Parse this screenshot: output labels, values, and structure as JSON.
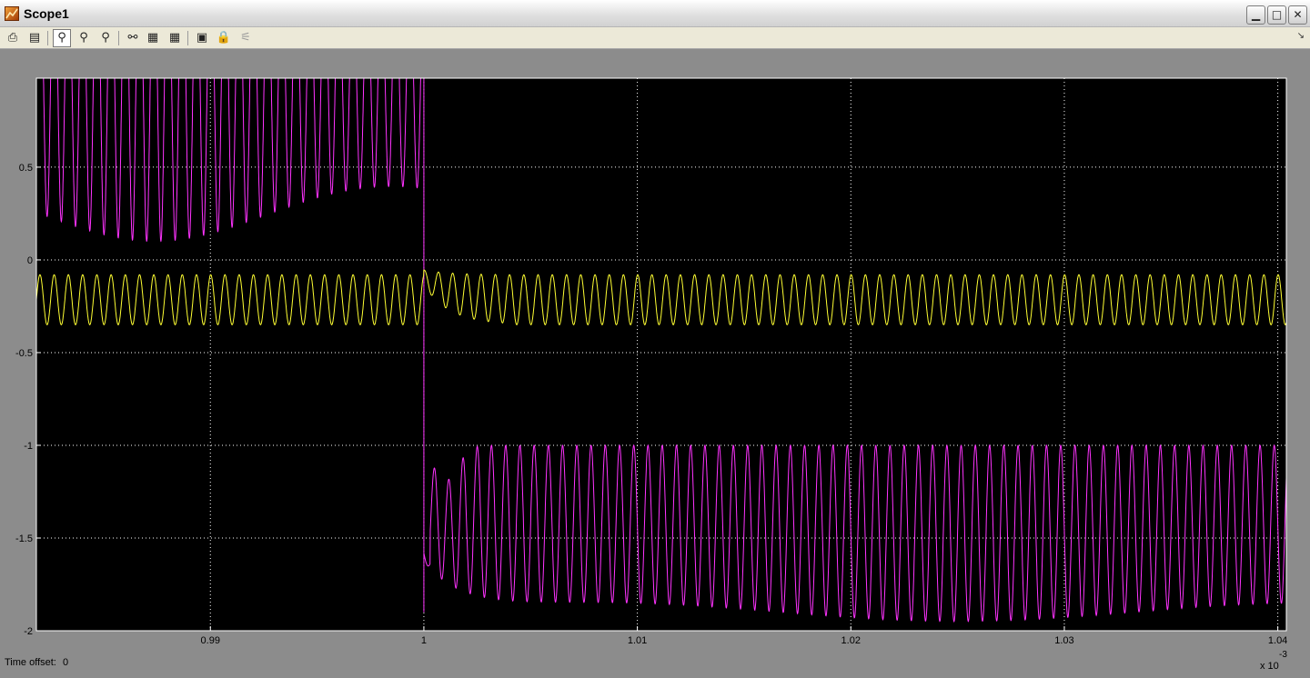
{
  "window": {
    "title": "Scope1",
    "controls": [
      "minimize",
      "maximize",
      "close"
    ]
  },
  "toolbar": {
    "buttons": [
      {
        "name": "print-icon",
        "glyph": "⎙",
        "state": "enabled"
      },
      {
        "name": "parameters-icon",
        "glyph": "▤",
        "state": "enabled"
      },
      {
        "name": "zoom-icon",
        "glyph": "⚲",
        "state": "active"
      },
      {
        "name": "zoom-x-icon",
        "glyph": "⚲",
        "state": "enabled"
      },
      {
        "name": "zoom-y-icon",
        "glyph": "⚲",
        "state": "enabled"
      },
      {
        "name": "autoscale-icon",
        "glyph": "⚯",
        "state": "enabled"
      },
      {
        "name": "save-axes-icon",
        "glyph": "▦",
        "state": "enabled"
      },
      {
        "name": "restore-axes-icon",
        "glyph": "▦",
        "state": "enabled"
      },
      {
        "name": "floating-scope-icon",
        "glyph": "▣",
        "state": "enabled"
      },
      {
        "name": "lock-axes-icon",
        "glyph": "🔒",
        "state": "disabled"
      },
      {
        "name": "signal-selection-icon",
        "glyph": "⚟",
        "state": "disabled"
      }
    ],
    "menu_arrow": "↘"
  },
  "status": {
    "time_offset_label": "Time offset:",
    "time_offset_value": "0"
  },
  "chart_data": {
    "type": "line",
    "background": "#000000",
    "grid": true,
    "grid_style": "dotted",
    "xlim": [
      0.98185,
      1.0404
    ],
    "ylim": [
      -2,
      0.98
    ],
    "x_ticks": [
      0.99,
      1,
      1.01,
      1.02,
      1.03,
      1.04
    ],
    "x_tick_labels": [
      "0.99",
      "1",
      "1.01",
      "1.02",
      "1.03",
      "1.04"
    ],
    "x_multiplier_base": "x 10",
    "x_multiplier_exponent": "-3",
    "y_ticks": [
      0.5,
      0,
      -0.5,
      -1,
      -1.5,
      -2
    ],
    "y_tick_labels": [
      "0.5",
      "0",
      "-0.5",
      "-1",
      "-1.5",
      "-2"
    ],
    "series": [
      {
        "color": "#ff33ff",
        "description": "high-frequency ripple between 0.98 and ~0.1 before t=1; steps down at t=1; transient dip toward ~-1.9 then ripple between -1 and ~-1.9",
        "segments": [
          {
            "x_start": 0.98185,
            "x_end": 1.0,
            "upper": 0.98,
            "lower": 0.1
          },
          {
            "x_start": 1.0,
            "x_end": 1.0406,
            "upper": -1.0,
            "lower": -1.9,
            "transient_min": -1.95,
            "transient_x": 1.0002
          }
        ]
      },
      {
        "color": "#ffff33",
        "description": "ripple between ~-0.08 and ~-0.35 throughout, brief disturbance at t=1",
        "segments": [
          {
            "x_start": 0.98185,
            "x_end": 1.0406,
            "upper": -0.08,
            "lower": -0.35
          }
        ]
      }
    ]
  }
}
